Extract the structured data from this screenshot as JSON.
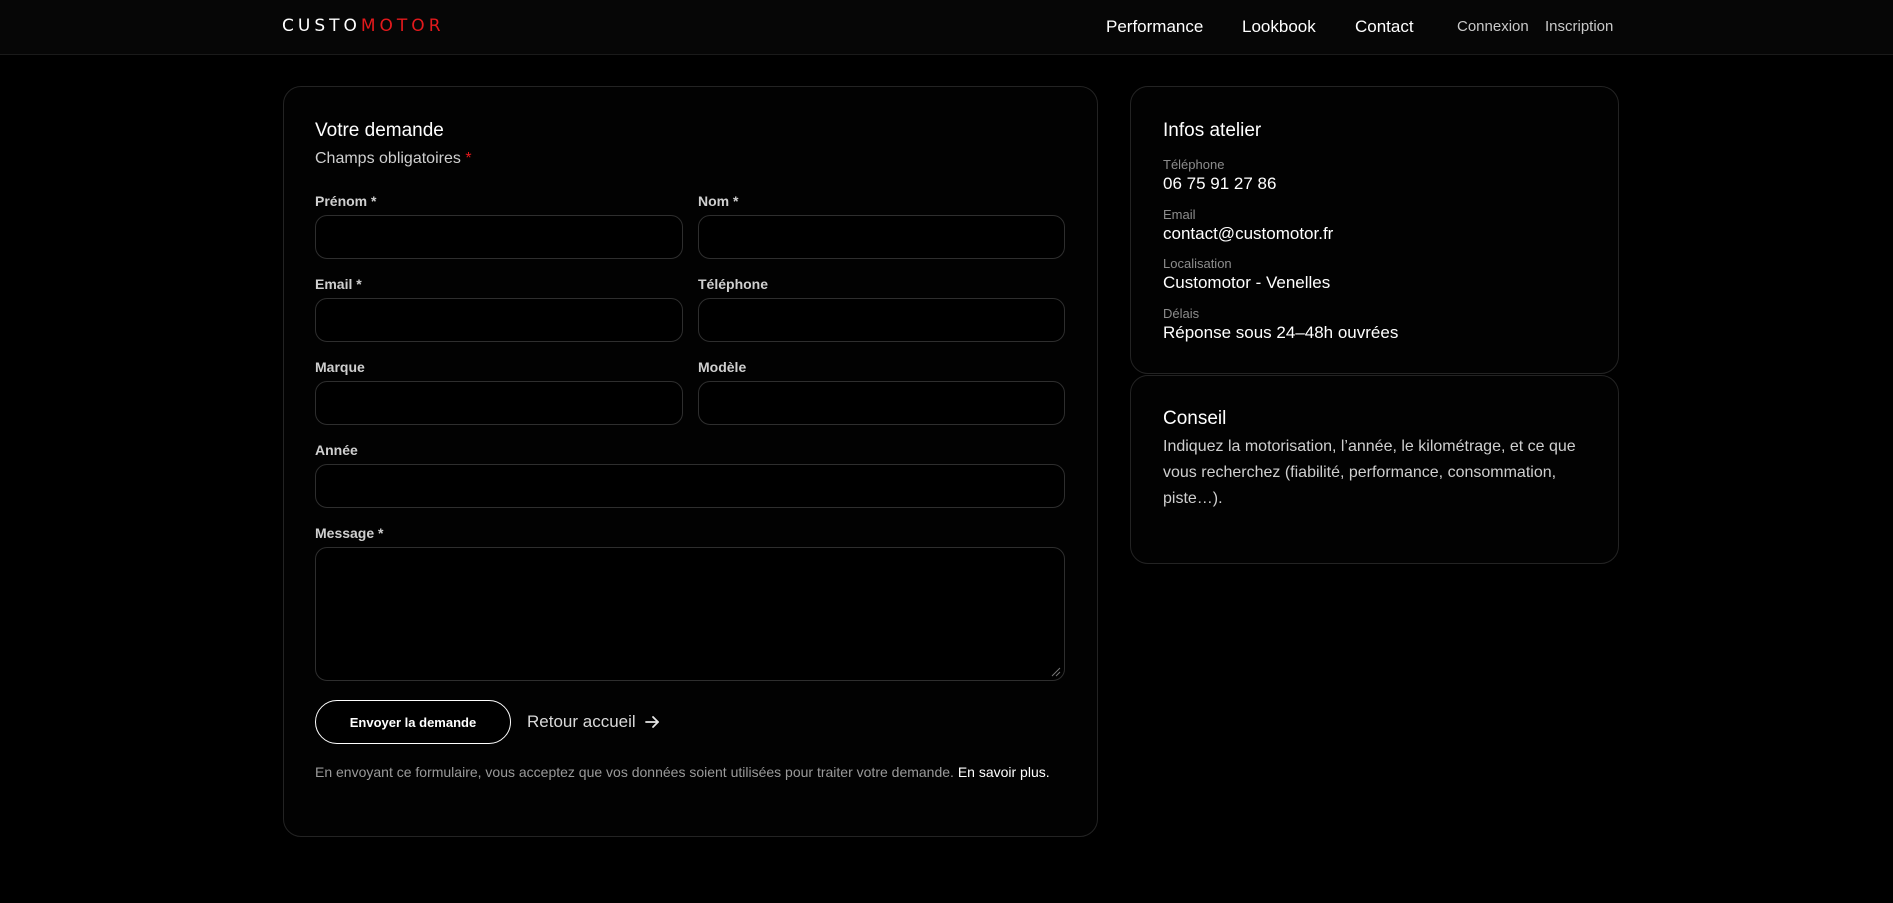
{
  "header": {
    "logo_part1": "CUSTO",
    "logo_part2": "MOTOR",
    "nav": [
      "Performance",
      "Lookbook",
      "Contact"
    ],
    "login": "Connexion",
    "signup": "Inscription"
  },
  "form": {
    "title": "Votre demande",
    "required_note": "Champs obligatoires",
    "required_star": "*",
    "fields": {
      "prenom": "Prénom *",
      "nom": "Nom *",
      "email": "Email *",
      "telephone": "Téléphone",
      "marque": "Marque",
      "modele": "Modèle",
      "annee": "Année",
      "message": "Message *"
    },
    "submit_label": "Envoyer la demande",
    "back_label": "Retour accueil",
    "legal_text": "En envoyant ce formulaire, vous acceptez que vos données soient utilisées pour traiter votre demande. ",
    "legal_link": "En savoir plus."
  },
  "atelier": {
    "title": "Infos atelier",
    "items": [
      {
        "label": "Téléphone",
        "value": "06 75 91 27 86"
      },
      {
        "label": "Email",
        "value": "contact@customotor.fr"
      },
      {
        "label": "Localisation",
        "value": "Customotor - Venelles"
      },
      {
        "label": "Délais",
        "value": "Réponse sous 24–48h ouvrées"
      }
    ]
  },
  "conseil": {
    "title": "Conseil",
    "text": "Indiquez la motorisation, l’année, le kilométrage, et ce que vous recherchez (fiabilité, performance, consommation, piste…)."
  },
  "colors": {
    "accent": "#e3191c",
    "background": "#000000"
  }
}
